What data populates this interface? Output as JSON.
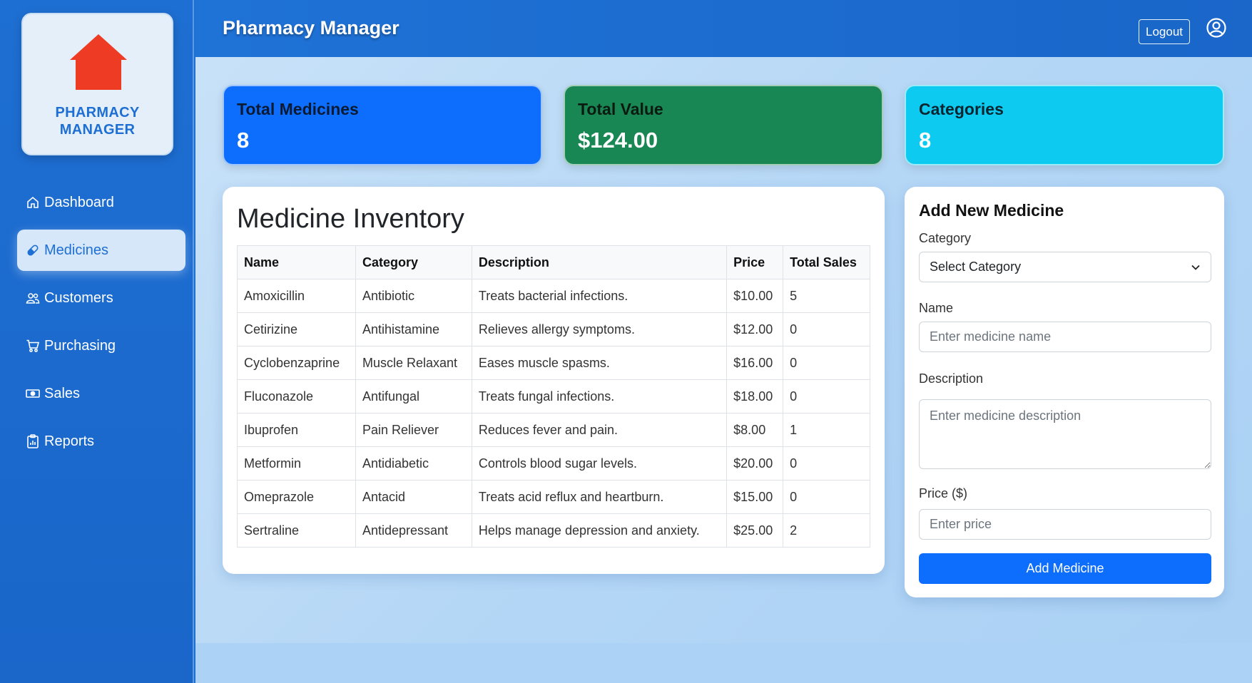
{
  "sidebar": {
    "logo_text": "PHARMACY MANAGER",
    "items": [
      {
        "label": "Dashboard",
        "icon": "home-icon"
      },
      {
        "label": "Medicines",
        "icon": "capsule-icon",
        "active": true
      },
      {
        "label": "Customers",
        "icon": "people-icon"
      },
      {
        "label": "Purchasing",
        "icon": "cart-icon"
      },
      {
        "label": "Sales",
        "icon": "cash-icon"
      },
      {
        "label": "Reports",
        "icon": "clipboard-data-icon"
      }
    ]
  },
  "header": {
    "title": "Pharmacy Manager",
    "logout_label": "Logout",
    "user_icon": "person-circle-icon"
  },
  "stats": {
    "total_medicines": {
      "label": "Total Medicines",
      "value": "8"
    },
    "total_value": {
      "label": "Total Value",
      "value": "$124.00"
    },
    "categories": {
      "label": "Categories",
      "value": "8"
    }
  },
  "inventory": {
    "title": "Medicine Inventory",
    "columns": [
      "Name",
      "Category",
      "Description",
      "Price",
      "Total Sales"
    ],
    "rows": [
      [
        "Amoxicillin",
        "Antibiotic",
        "Treats bacterial infections.",
        "$10.00",
        "5"
      ],
      [
        "Cetirizine",
        "Antihistamine",
        "Relieves allergy symptoms.",
        "$12.00",
        "0"
      ],
      [
        "Cyclobenzaprine",
        "Muscle Relaxant",
        "Eases muscle spasms.",
        "$16.00",
        "0"
      ],
      [
        "Fluconazole",
        "Antifungal",
        "Treats fungal infections.",
        "$18.00",
        "0"
      ],
      [
        "Ibuprofen",
        "Pain Reliever",
        "Reduces fever and pain.",
        "$8.00",
        "1"
      ],
      [
        "Metformin",
        "Antidiabetic",
        "Controls blood sugar levels.",
        "$20.00",
        "0"
      ],
      [
        "Omeprazole",
        "Antacid",
        "Treats acid reflux and heartburn.",
        "$15.00",
        "0"
      ],
      [
        "Sertraline",
        "Antidepressant",
        "Helps manage depression and anxiety.",
        "$25.00",
        "2"
      ]
    ]
  },
  "form": {
    "title": "Add New Medicine",
    "category_label": "Category",
    "category_selected": "Select Category",
    "name_label": "Name",
    "name_placeholder": "Enter medicine name",
    "description_label": "Description",
    "description_placeholder": "Enter medicine description",
    "price_label": "Price ($)",
    "price_placeholder": "Enter price",
    "submit_label": "Add Medicine"
  },
  "colors": {
    "primary": "#0d6efd",
    "success": "#198754",
    "info": "#0dcaf0",
    "sidebar": "#1e6fd3",
    "logo_house": "#ee3b24"
  }
}
